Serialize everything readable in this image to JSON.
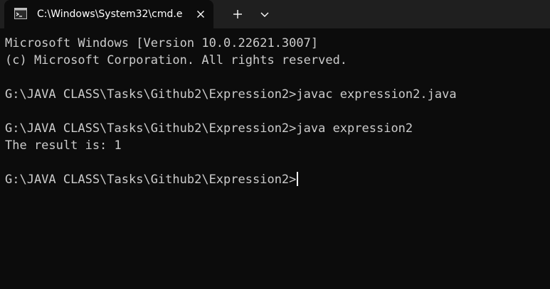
{
  "titlebar": {
    "tab_title": "C:\\Windows\\System32\\cmd.e",
    "tab_icon": "cmd-terminal-icon",
    "close_icon": "close-icon",
    "new_tab_icon": "plus-icon",
    "dropdown_icon": "chevron-down-icon"
  },
  "console": {
    "lines": [
      "Microsoft Windows [Version 10.0.22621.3007]",
      "(c) Microsoft Corporation. All rights reserved.",
      "",
      "G:\\JAVA CLASS\\Tasks\\Github2\\Expression2>javac expression2.java",
      "",
      "G:\\JAVA CLASS\\Tasks\\Github2\\Expression2>java expression2",
      "The result is: 1",
      "",
      "G:\\JAVA CLASS\\Tasks\\Github2\\Expression2>"
    ]
  },
  "colors": {
    "background": "#0c0c0c",
    "titlebar": "#1f1f1f",
    "text": "#cccccc"
  }
}
